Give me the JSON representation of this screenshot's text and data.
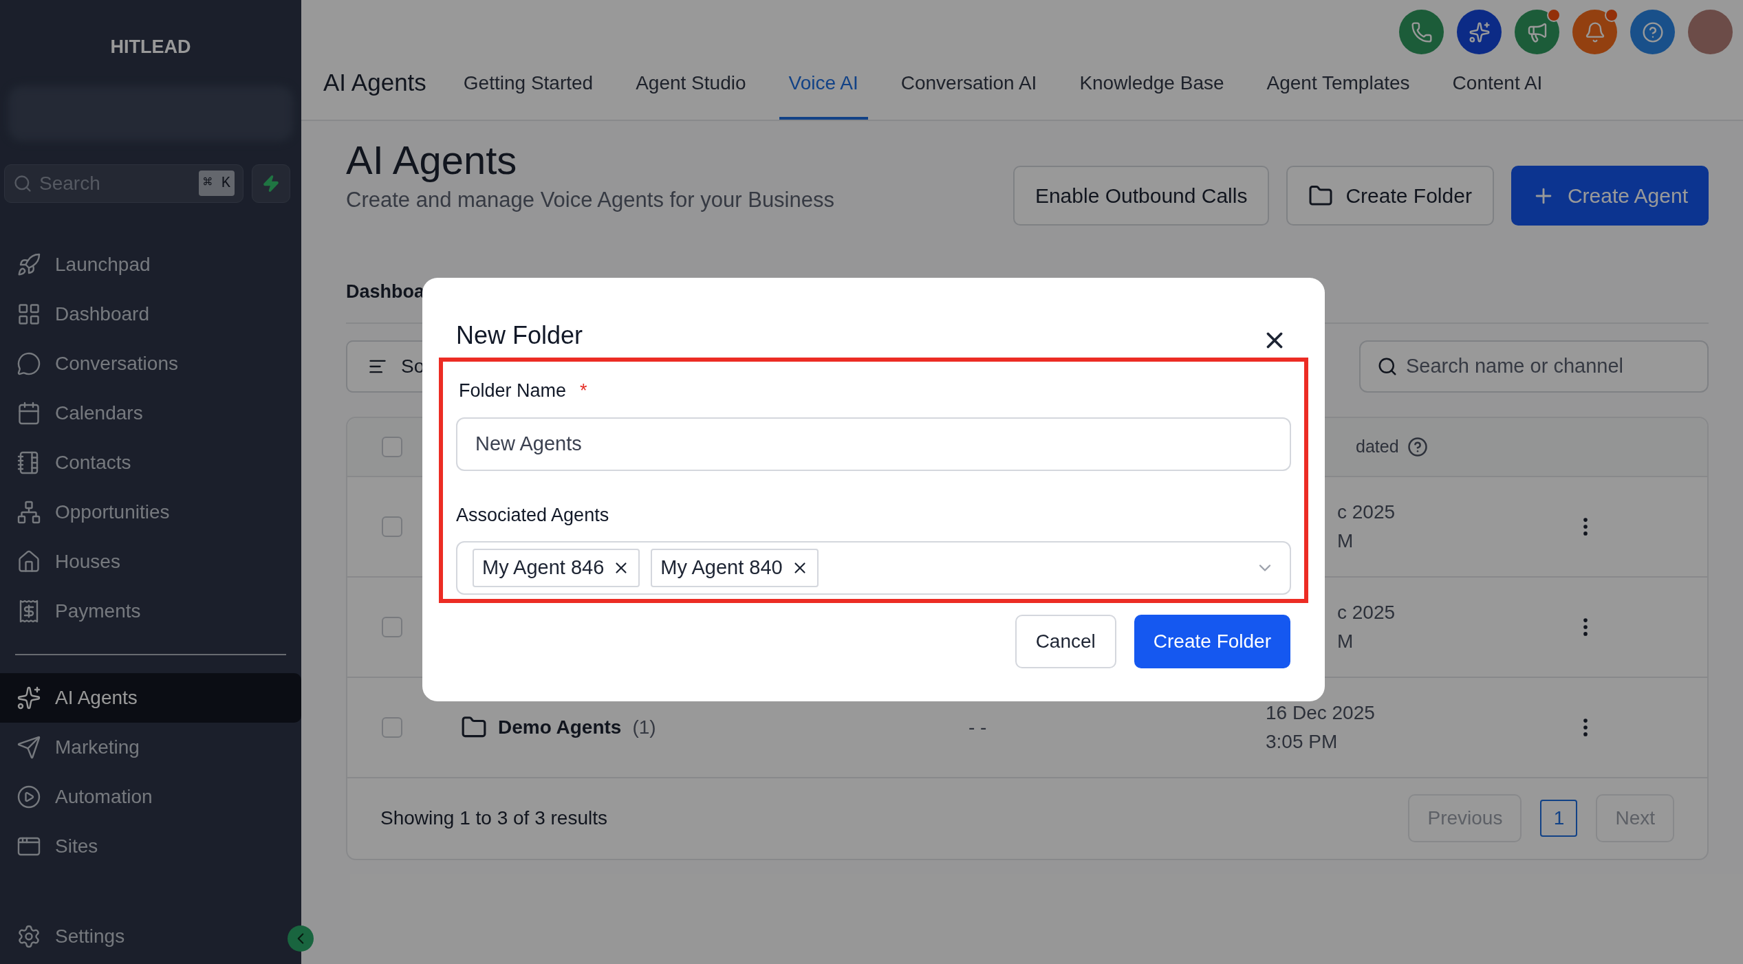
{
  "brand": "HITLEAD",
  "sidebar": {
    "search": {
      "placeholder": "Search",
      "shortcut": "⌘ K"
    },
    "main_items": [
      {
        "label": "Launchpad",
        "selected": false
      },
      {
        "label": "Dashboard",
        "selected": false
      },
      {
        "label": "Conversations",
        "selected": false
      },
      {
        "label": "Calendars",
        "selected": false
      },
      {
        "label": "Contacts",
        "selected": false
      },
      {
        "label": "Opportunities",
        "selected": false
      },
      {
        "label": "Houses",
        "selected": false
      },
      {
        "label": "Payments",
        "selected": false
      }
    ],
    "ai_items": [
      {
        "label": "AI Agents",
        "selected": true
      },
      {
        "label": "Marketing",
        "selected": false
      },
      {
        "label": "Automation",
        "selected": false
      },
      {
        "label": "Sites",
        "selected": false
      }
    ],
    "settings": {
      "label": "Settings"
    }
  },
  "top_icons": [
    {
      "kind": "phone",
      "badge": false
    },
    {
      "kind": "sparkles",
      "badge": false
    },
    {
      "kind": "megaphone",
      "badge": true
    },
    {
      "kind": "bell",
      "badge": true
    },
    {
      "kind": "help",
      "badge": false
    },
    {
      "kind": "avatar",
      "badge": false
    }
  ],
  "header": {
    "section_title": "AI Agents",
    "tabs": [
      {
        "label": "Getting Started",
        "selected": false
      },
      {
        "label": "Agent Studio",
        "selected": false
      },
      {
        "label": "Voice AI",
        "selected": true
      },
      {
        "label": "Conversation AI",
        "selected": false
      },
      {
        "label": "Knowledge Base",
        "selected": false
      },
      {
        "label": "Agent Templates",
        "selected": false
      },
      {
        "label": "Content AI",
        "selected": false
      }
    ]
  },
  "page": {
    "title": "AI Agents",
    "subtitle": "Create and manage Voice Agents for your Business",
    "buttons": [
      {
        "label": "Enable Outbound Calls",
        "kind": "outline"
      },
      {
        "label": "Create Folder",
        "kind": "folder"
      },
      {
        "label": "Create Agent",
        "kind": "primary"
      }
    ],
    "view_tab": "Dashboa",
    "sort_button": "So",
    "search": {
      "placeholder": "Search name or channel"
    }
  },
  "table": {
    "select_all": {
      "checked": false
    },
    "columns": [
      {
        "label": "dated",
        "help": true
      }
    ],
    "rows": [
      {
        "checked": false,
        "date": "c 2025",
        "time": "M"
      },
      {
        "checked": false,
        "date": "c 2025",
        "time": "M"
      },
      {
        "checked": false,
        "name": "Demo Agents",
        "count": "(1)",
        "column_3": "- -",
        "date": "16 Dec 2025",
        "time": "3:05 PM"
      }
    ],
    "summary": "Showing 1 to 3 of 3 results",
    "pagination": {
      "previous": {
        "label": "Previous",
        "disabled": true
      },
      "pages": [
        {
          "label": "1",
          "selected": true
        }
      ],
      "next": {
        "label": "Next",
        "disabled": true
      }
    }
  },
  "modal": {
    "title": "New Folder",
    "highlight": true,
    "folder_name": {
      "label": "Folder Name",
      "required_mark": "*",
      "value": "New Agents"
    },
    "associated_agents": {
      "label": "Associated Agents",
      "chips": [
        {
          "label": "My Agent 846"
        },
        {
          "label": "My Agent 840"
        }
      ]
    },
    "buttons": [
      {
        "label": "Cancel",
        "kind": "secondary"
      },
      {
        "label": "Create Folder",
        "kind": "primary"
      }
    ]
  }
}
